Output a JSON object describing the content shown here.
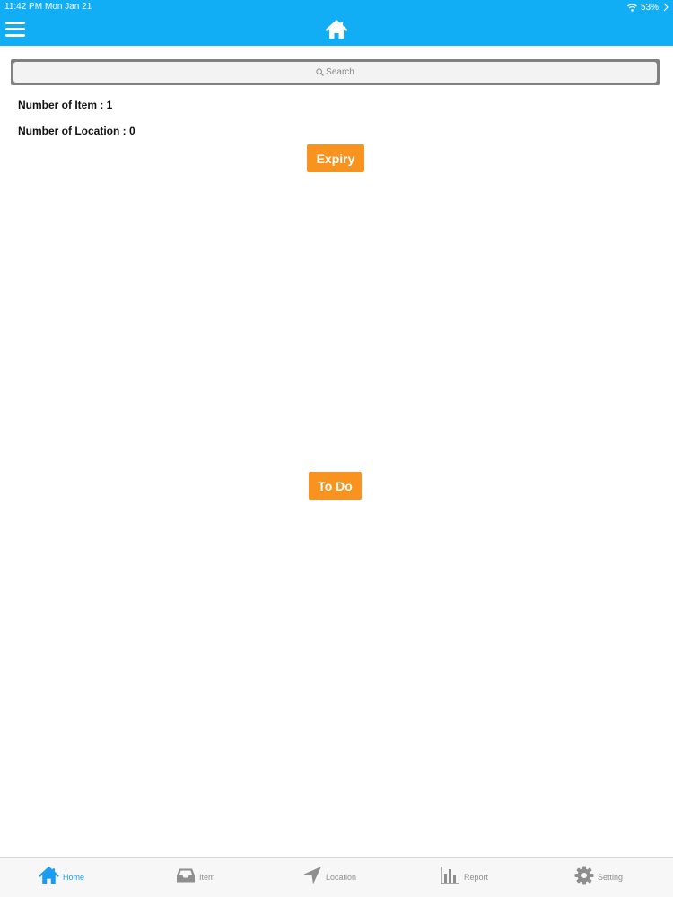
{
  "status_bar": {
    "time": "11:42 PM",
    "date": "Mon Jan 21",
    "battery": "53%"
  },
  "nav_bar": {
    "center_icon": "home-icon",
    "left_icon": "hamburger-menu-icon"
  },
  "search": {
    "placeholder": "Search"
  },
  "summary": {
    "items_line": "Number of Item : 1",
    "locations_line": "Number of Location : 0"
  },
  "buttons": {
    "expiry": "Expiry",
    "todo": "To Do"
  },
  "tab_bar": {
    "active": "Home",
    "tabs": [
      {
        "label": "Home",
        "icon": "home-icon"
      },
      {
        "label": "Item",
        "icon": "inbox-tray-icon"
      },
      {
        "label": "Location",
        "icon": "location-arrow-icon"
      },
      {
        "label": "Report",
        "icon": "bar-chart-icon"
      },
      {
        "label": "Setting",
        "icon": "gear-icon"
      }
    ]
  },
  "colors": {
    "header": "#12aef5",
    "button": "#f7931e",
    "active_tab": "#1a9df0",
    "inactive_tab": "#8e8e8e"
  }
}
